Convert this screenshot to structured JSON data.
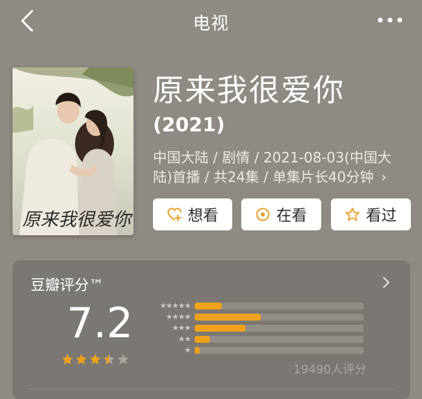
{
  "nav": {
    "title": "电视"
  },
  "movie": {
    "title": "原来我很爱你",
    "year": "(2021)",
    "meta": "中国大陆 / 剧情 / 2021-08-03(中国大陆)首播 / 共24集 / 单集片长40分钟",
    "meta_arrow": "›",
    "poster_alt": "原来我很爱你 poster"
  },
  "actions": {
    "want": "想看",
    "watching": "在看",
    "watched": "看过"
  },
  "rating": {
    "label": "豆瓣评分™",
    "score": "7.2",
    "stars_value": 3.5,
    "count": "19490人评分",
    "distribution": [
      {
        "stars": "★★★★★",
        "fraction": 0.16
      },
      {
        "stars": "★★★★",
        "fraction": 0.39
      },
      {
        "stars": "★★★",
        "fraction": 0.3
      },
      {
        "stars": "★★",
        "fraction": 0.09
      },
      {
        "stars": "★",
        "fraction": 0.03
      }
    ]
  },
  "colors": {
    "background": "#8f8a83",
    "card": "#7b7873",
    "star": "#f0a21a"
  }
}
